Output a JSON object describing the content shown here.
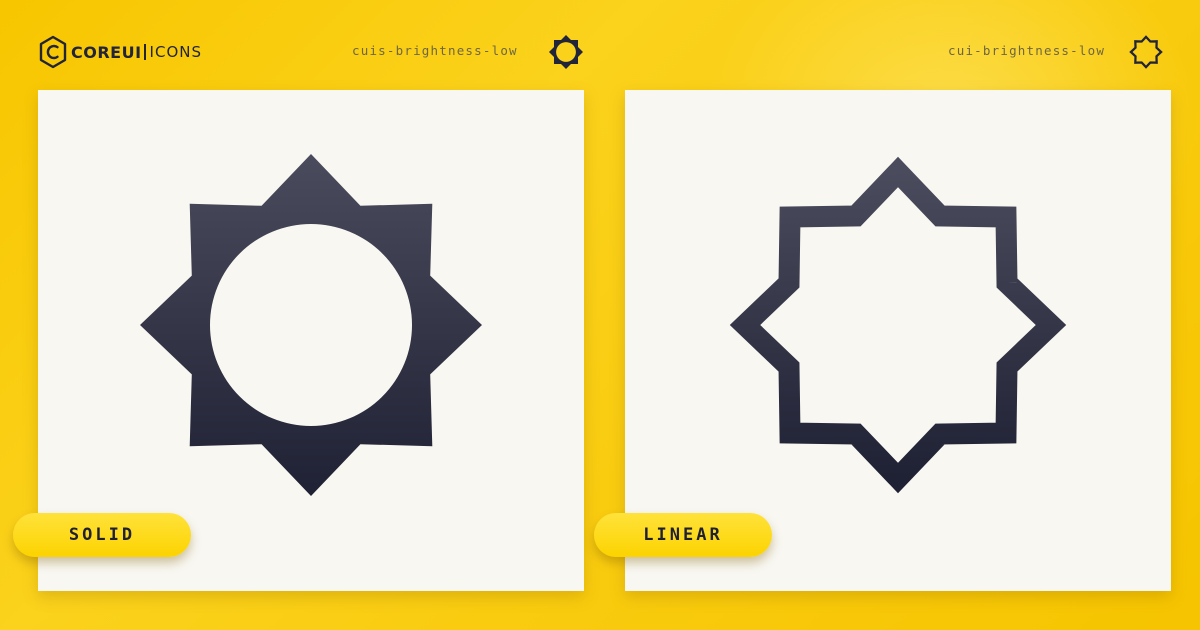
{
  "logo": {
    "bold": "COREUI",
    "light": "ICONS"
  },
  "icons": {
    "solid": {
      "name": "cuis-brightness-low",
      "style_label": "SOLID",
      "icon": "brightness-low-solid-icon"
    },
    "linear": {
      "name": "cui-brightness-low",
      "style_label": "LINEAR",
      "icon": "brightness-low-linear-icon"
    }
  },
  "colors": {
    "background": "#f9cd12",
    "card": "#f8f7f1",
    "icon_top": "#4a4b5c",
    "icon_bottom": "#1f2134",
    "pill": "#fcd300"
  }
}
